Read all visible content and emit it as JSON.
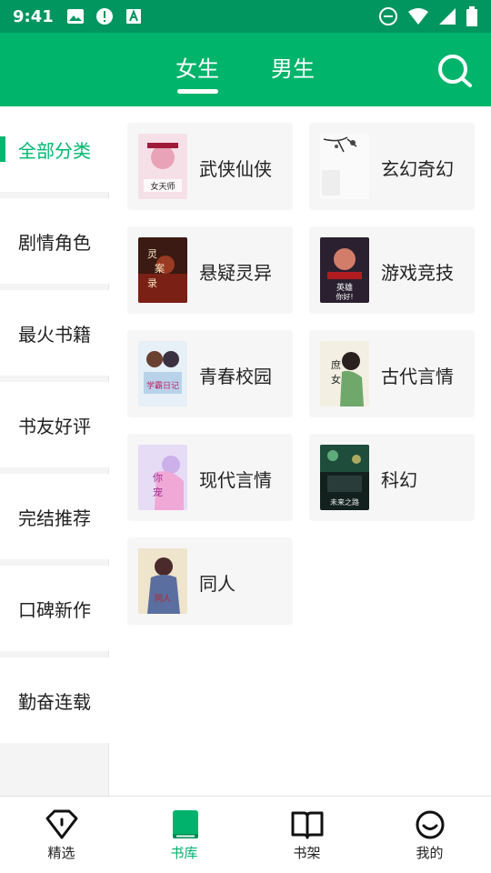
{
  "status_bar": {
    "time": "9:41"
  },
  "header": {
    "tabs": [
      {
        "label": "女生",
        "active": true
      },
      {
        "label": "男生",
        "active": false
      }
    ],
    "colors": {
      "bar": "#01b46b",
      "status": "#01955f"
    }
  },
  "sidebar": {
    "items": [
      {
        "label": "全部分类",
        "active": true
      },
      {
        "label": "剧情角色",
        "active": false
      },
      {
        "label": "最火书籍",
        "active": false
      },
      {
        "label": "书友好评",
        "active": false
      },
      {
        "label": "完结推荐",
        "active": false
      },
      {
        "label": "口碑新作",
        "active": false
      },
      {
        "label": "勤奋连载",
        "active": false
      }
    ],
    "accent": "#00b76f"
  },
  "categories": [
    {
      "name": "武侠仙侠",
      "cover_text": "女天师"
    },
    {
      "name": "玄幻奇幻",
      "cover_text": ""
    },
    {
      "name": "悬疑灵异",
      "cover_text": "灵案录"
    },
    {
      "name": "游戏竞技",
      "cover_text": "英雄你好!"
    },
    {
      "name": "青春校园",
      "cover_text": "学霸日记"
    },
    {
      "name": "古代言情",
      "cover_text": "庶女"
    },
    {
      "name": "现代言情",
      "cover_text": "你宠"
    },
    {
      "name": "科幻",
      "cover_text": "未来之路"
    },
    {
      "name": "同人",
      "cover_text": "同人"
    }
  ],
  "bottom_nav": [
    {
      "label": "精选",
      "icon": "diamond-icon",
      "active": false
    },
    {
      "label": "书库",
      "icon": "book-icon",
      "active": true
    },
    {
      "label": "书架",
      "icon": "open-book-icon",
      "active": false
    },
    {
      "label": "我的",
      "icon": "smiley-icon",
      "active": false
    }
  ]
}
